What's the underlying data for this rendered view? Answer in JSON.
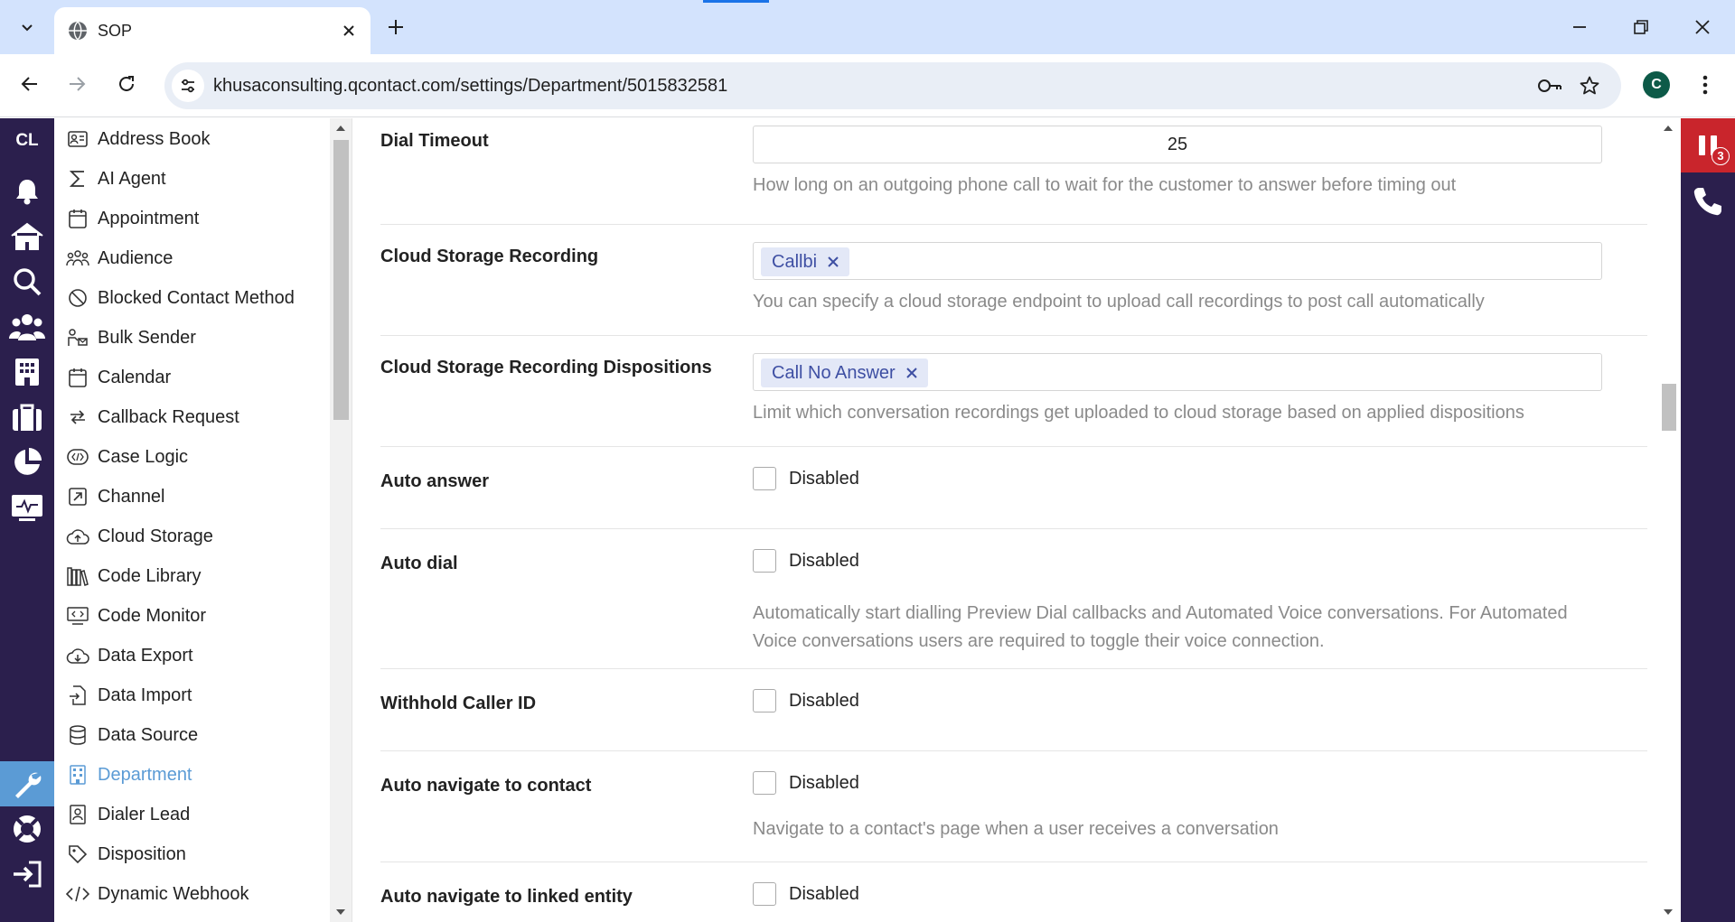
{
  "browser": {
    "tab_title": "SOP",
    "url": "khusaconsulting.qcontact.com/settings/Department/5015832581",
    "profile_initial": "C"
  },
  "app": {
    "logo": "CL",
    "rail_items": [
      "bell-icon",
      "home-icon",
      "search-icon",
      "users-icon",
      "building-icon",
      "briefcase-icon",
      "pie-chart-icon",
      "monitor-icon",
      "wrench-icon",
      "help-icon",
      "logout-icon"
    ],
    "active_rail_item": "wrench-icon",
    "notifications_count": "3",
    "accent_color": "#5b9bd5",
    "rail_color": "#2b1f4d"
  },
  "nav": {
    "items": [
      {
        "label": "Address Book",
        "icon": "address-book-icon"
      },
      {
        "label": "AI Agent",
        "icon": "sigma-icon"
      },
      {
        "label": "Appointment",
        "icon": "calendar-icon"
      },
      {
        "label": "Audience",
        "icon": "audience-icon"
      },
      {
        "label": "Blocked Contact Method",
        "icon": "blocked-icon"
      },
      {
        "label": "Bulk Sender",
        "icon": "bulk-sender-icon"
      },
      {
        "label": "Calendar",
        "icon": "calendar-icon"
      },
      {
        "label": "Callback Request",
        "icon": "callback-icon"
      },
      {
        "label": "Case Logic",
        "icon": "case-logic-icon"
      },
      {
        "label": "Channel",
        "icon": "channel-icon"
      },
      {
        "label": "Cloud Storage",
        "icon": "cloud-upload-icon"
      },
      {
        "label": "Code Library",
        "icon": "library-icon"
      },
      {
        "label": "Code Monitor",
        "icon": "code-monitor-icon"
      },
      {
        "label": "Data Export",
        "icon": "cloud-download-icon"
      },
      {
        "label": "Data Import",
        "icon": "file-import-icon"
      },
      {
        "label": "Data Source",
        "icon": "database-icon"
      },
      {
        "label": "Department",
        "icon": "building-icon"
      },
      {
        "label": "Dialer Lead",
        "icon": "contact-card-icon"
      },
      {
        "label": "Disposition",
        "icon": "tag-icon"
      },
      {
        "label": "Dynamic Webhook",
        "icon": "code-icon"
      }
    ],
    "active_item": "Department"
  },
  "settings": {
    "dial_timeout": {
      "label": "Dial Timeout",
      "value": "25",
      "help": "How long on an outgoing phone call to wait for the customer to answer before timing out"
    },
    "cloud_storage_recording": {
      "label": "Cloud Storage Recording",
      "chip": "Callbi",
      "help": "You can specify a cloud storage endpoint to upload call recordings to post call automatically"
    },
    "cloud_storage_recording_dispositions": {
      "label": "Cloud Storage Recording Dispositions",
      "chip": "Call No Answer",
      "help": "Limit which conversation recordings get uploaded to cloud storage based on applied dispositions"
    },
    "auto_answer": {
      "label": "Auto answer",
      "state": "Disabled"
    },
    "auto_dial": {
      "label": "Auto dial",
      "state": "Disabled",
      "help_line1": "Automatically start dialling Preview Dial callbacks and Automated Voice conversations. For Automated",
      "help_line2": "Voice conversations users are required to toggle their voice connection."
    },
    "withhold_caller_id": {
      "label": "Withhold Caller ID",
      "state": "Disabled"
    },
    "auto_navigate_contact": {
      "label": "Auto navigate to contact",
      "state": "Disabled",
      "help": "Navigate to a contact's page when a user receives a conversation"
    },
    "auto_navigate_linked": {
      "label": "Auto navigate to linked entity",
      "state": "Disabled"
    }
  }
}
